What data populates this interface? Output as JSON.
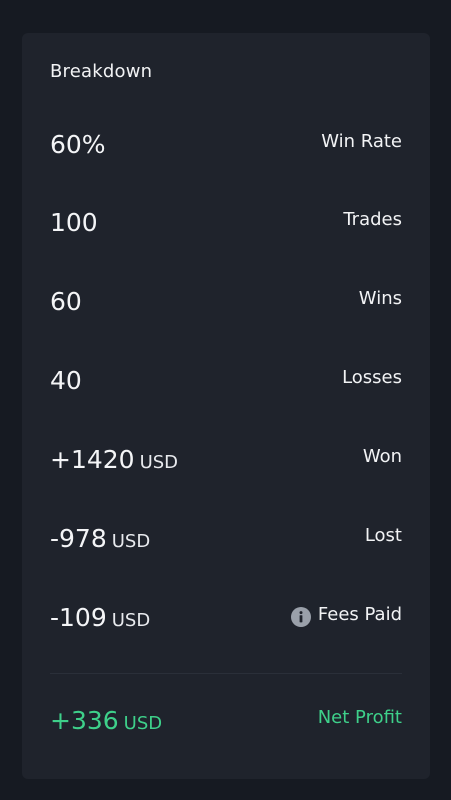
{
  "card": {
    "title": "Breakdown",
    "rows": [
      {
        "value": "60%",
        "unit": "",
        "label": "Win Rate"
      },
      {
        "value": "100",
        "unit": "",
        "label": "Trades"
      },
      {
        "value": "60",
        "unit": "",
        "label": "Wins"
      },
      {
        "value": "40",
        "unit": "",
        "label": "Losses"
      },
      {
        "value": "+1420",
        "unit": "USD",
        "label": "Won"
      },
      {
        "value": "-978",
        "unit": "USD",
        "label": "Lost"
      },
      {
        "value": "-109",
        "unit": "USD",
        "label": "Fees Paid",
        "icon": "info-icon"
      }
    ],
    "net": {
      "value": "+336",
      "unit": "USD",
      "label": "Net Profit"
    }
  },
  "colors": {
    "background": "#161a22",
    "card": "#1f232c",
    "positive": "#3ed08a",
    "icon": "#9aa0aa"
  }
}
